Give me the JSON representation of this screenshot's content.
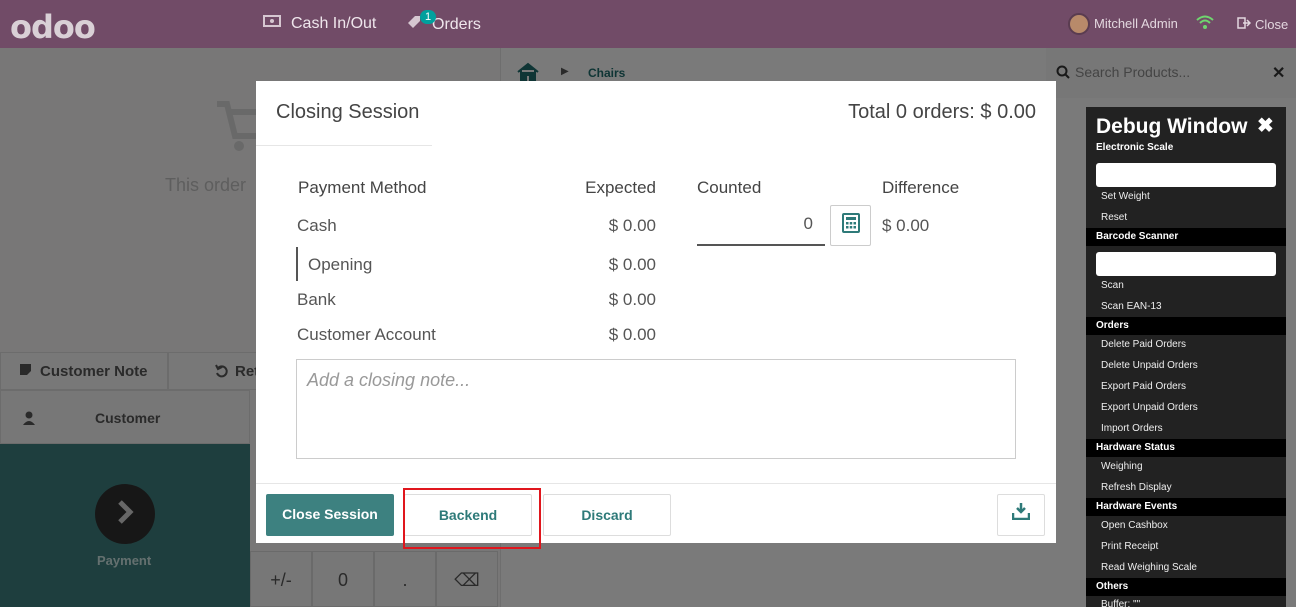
{
  "topbar": {
    "logo": "odoo",
    "cash_in_out": "Cash In/Out",
    "orders": "Orders",
    "orders_badge": "1",
    "user_name": "Mitchell Admin",
    "close": "Close"
  },
  "background": {
    "empty_cart_text": "This order",
    "customer_note": "Customer Note",
    "refund_partial": "Ret",
    "customer": "Customer",
    "payment": "Payment",
    "numpad_keys": [
      "+/-",
      "0",
      ".",
      "⌫"
    ],
    "breadcrumb_category": "Chairs",
    "search_placeholder": "Search Products..."
  },
  "debug": {
    "title": "Debug Window",
    "sections": {
      "electronic_scale": "Electronic Scale",
      "barcode_scanner": "Barcode Scanner",
      "orders": "Orders",
      "hardware_status": "Hardware Status",
      "hardware_events": "Hardware Events",
      "others": "Others"
    },
    "items": {
      "set_weight": "Set Weight",
      "reset": "Reset",
      "scan": "Scan",
      "scan_ean": "Scan EAN-13",
      "delete_paid": "Delete Paid Orders",
      "delete_unpaid": "Delete Unpaid Orders",
      "export_paid": "Export Paid Orders",
      "export_unpaid": "Export Unpaid Orders",
      "import_orders": "Import Orders",
      "weighing": "Weighing",
      "refresh_display": "Refresh Display",
      "open_cashbox": "Open Cashbox",
      "print_receipt": "Print Receipt",
      "read_weighing_scale": "Read Weighing Scale",
      "buffer": "Buffer: \"\""
    }
  },
  "modal": {
    "title": "Closing Session",
    "total": "Total 0 orders: $ 0.00",
    "headers": {
      "method": "Payment Method",
      "expected": "Expected",
      "counted": "Counted",
      "difference": "Difference"
    },
    "rows": [
      {
        "method": "Cash",
        "expected": "$ 0.00",
        "counted": "0",
        "difference": "$ 0.00"
      },
      {
        "method": "Opening",
        "expected": "$ 0.00"
      },
      {
        "method": "Bank",
        "expected": "$ 0.00"
      },
      {
        "method": "Customer Account",
        "expected": "$ 0.00"
      }
    ],
    "note_placeholder": "Add a closing note...",
    "buttons": {
      "close_session": "Close Session",
      "backend": "Backend",
      "discard": "Discard"
    }
  }
}
